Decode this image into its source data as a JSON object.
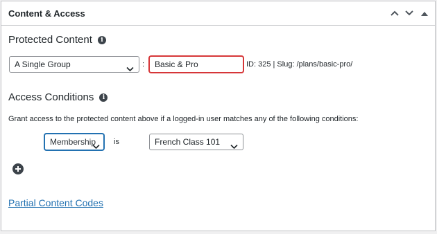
{
  "panel": {
    "title": "Content & Access"
  },
  "protected_content": {
    "heading": "Protected Content",
    "type_select": "A Single Group",
    "separator": ":",
    "group_input_value": "Basic & Pro",
    "meta": "ID: 325 | Slug: /plans/basic-pro/"
  },
  "access_conditions": {
    "heading": "Access Conditions",
    "description": "Grant access to the protected content above if a logged-in user matches any of the following conditions:",
    "condition": {
      "field_select": "Membership",
      "operator": "is",
      "value_select": "French Class 101"
    }
  },
  "partial_content_link": "Partial Content Codes",
  "icons": {
    "collapse_up": "chevron-up-icon",
    "collapse_down": "chevron-down-icon",
    "toggle": "triangle-up-icon",
    "info": "info-icon",
    "add": "plus-circle-icon"
  },
  "colors": {
    "accent": "#2271b1",
    "error_border": "#d63638",
    "text": "#1d2327"
  }
}
